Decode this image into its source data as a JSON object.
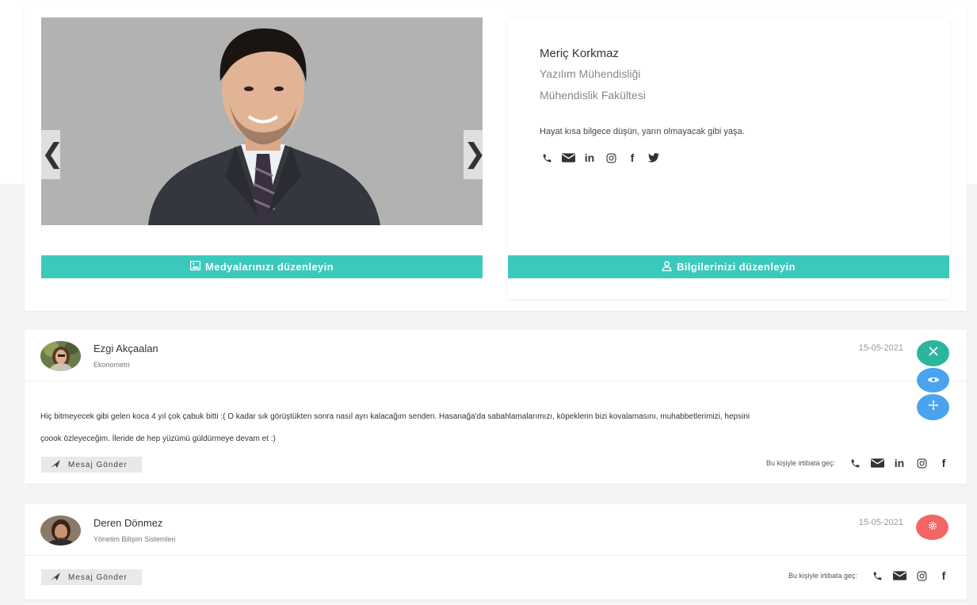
{
  "profile": {
    "name": "Meriç Korkmaz",
    "department": "Yazılım Mühendisliği",
    "faculty": "Mühendislik Fakültesi",
    "quote": "Hayat kısa bilgece düşün, yarın olmayacak gibi yaşa.",
    "social_icons": [
      "phone-icon",
      "mail-icon",
      "linkedin-icon",
      "instagram-icon",
      "facebook-icon",
      "twitter-icon"
    ]
  },
  "carousel": {
    "prev": "❮",
    "next": "❯"
  },
  "buttons": {
    "edit_media": "Medyalarınızı düzenleyin",
    "edit_info": "Bilgilerinizi düzenleyin"
  },
  "posts": [
    {
      "name": "Ezgi Akçaalan",
      "role": "Ekonometri",
      "date": "15-05-2021",
      "body_line1": "Hiç bitmeyecek gibi gelen koca 4 yıl çok çabuk bitti :( O kadar sık görüştükten sonra nasıl ayrı kalacağım senden. Hasanağa'da sabahlamalarımızı, köpeklerin bizi kovalamasını, muhabbetlerimizi, hepsini",
      "body_line2": "çoook özleyeceğim. İleride de hep yüzümü güldürmeye devam et :)",
      "send_label": "Mesaj Gönder",
      "contact_label": "Bu kişiyle irtibata geç:",
      "contact_icons": [
        "phone-icon",
        "mail-icon",
        "linkedin-icon",
        "instagram-icon",
        "facebook-icon"
      ]
    },
    {
      "name": "Deren Dönmez",
      "role": "Yönetim Bilişim Sistemleri",
      "date": "15-05-2021",
      "send_label": "Mesaj Gönder",
      "contact_label": "Bu kişiyle irtibata geç:",
      "contact_icons": [
        "phone-icon",
        "mail-icon",
        "instagram-icon",
        "facebook-icon"
      ]
    }
  ],
  "colors": {
    "accent": "#3cc9bd",
    "fab_close": "#2bb59c",
    "fab_blue": "#4aa3ef",
    "fab_gear": "#f26666"
  }
}
